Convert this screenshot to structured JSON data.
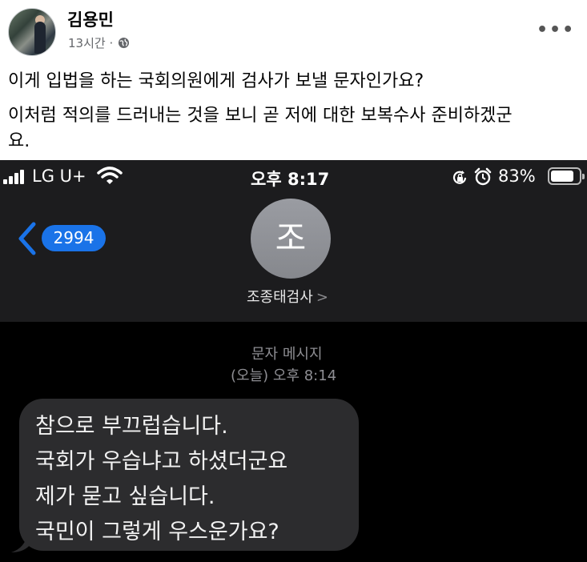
{
  "post": {
    "author": "김용민",
    "time": "13시간 ·",
    "visibility_icon": "globe-icon",
    "more_label": "•••",
    "text_lines": [
      "이게 입법을 하는 국회의원에게 검사가 보낼 문자인가요?",
      "이처럼 적의를 드러내는 것을 보니 곧 저에 대한 보복수사 준비하겠군",
      "요."
    ]
  },
  "phone": {
    "status": {
      "carrier": "LG U+",
      "time": "오후 8:17",
      "battery": "83%",
      "battery_level": 0.83
    },
    "nav": {
      "back_badge": "2994",
      "contact_initial": "조",
      "contact_name": "조종태검사",
      "contact_chevron": ">"
    },
    "thread": {
      "type_label": "문자 메시지",
      "timestamp": "(오늘) 오후 8:14",
      "message_lines": [
        "참으로 부끄럽습니다.",
        "국회가 우습냐고  하셨더군요",
        "제가 묻고 싶습니다.",
        "국민이 그렇게 우스운가요?"
      ]
    },
    "colors": {
      "header_bg": "#1c1c1e",
      "badge": "#1a73e8",
      "bubble": "#2c2c2e",
      "muted_text": "#8e8e93"
    }
  }
}
